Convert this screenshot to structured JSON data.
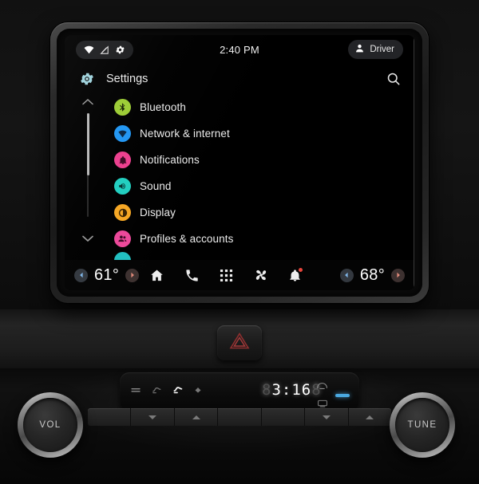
{
  "status_bar": {
    "icons": [
      "wifi-icon",
      "cellular-off-icon",
      "gear-icon"
    ],
    "time": "2:40 PM",
    "profile": {
      "label": "Driver",
      "icon": "person-icon"
    }
  },
  "app_header": {
    "icon": "settings-gear-icon",
    "title": "Settings",
    "search_icon": "search-icon"
  },
  "settings_list": {
    "scroll_up_icon": "chevron-up-icon",
    "scroll_down_icon": "chevron-down-icon",
    "items": [
      {
        "label": "Bluetooth",
        "icon": "bluetooth-icon",
        "color": "#9ccc34"
      },
      {
        "label": "Network & internet",
        "icon": "network-icon",
        "color": "#2196f3"
      },
      {
        "label": "Notifications",
        "icon": "bell-icon",
        "color": "#ec3f8e"
      },
      {
        "label": "Sound",
        "icon": "speaker-icon",
        "color": "#21cfc0"
      },
      {
        "label": "Display",
        "icon": "brightness-icon",
        "color": "#f5a623"
      },
      {
        "label": "Profiles & accounts",
        "icon": "people-icon",
        "color": "#ec4899"
      },
      {
        "label": "",
        "icon": "partial-icon",
        "color": "#21bfc0"
      }
    ]
  },
  "nav_bar": {
    "left_temp": "61°",
    "right_temp": "68°",
    "left_cool_icon": "arrow-left-cool-icon",
    "left_warm_icon": "arrow-right-warm-icon",
    "right_cool_icon": "arrow-left-cool-icon",
    "right_warm_icon": "arrow-right-warm-icon",
    "icons": [
      "home-icon",
      "phone-icon",
      "apps-grid-icon",
      "fan-icon",
      "bell-icon"
    ]
  },
  "hazard_button": {
    "icon": "hazard-triangle-icon"
  },
  "climate_panel": {
    "mode_icons": [
      "airflow-face-icon",
      "airflow-feet-icon",
      "airflow-mix-icon",
      "recirculate-icon"
    ],
    "clock": "3:16",
    "clock_ghost_prefix": "8",
    "clock_ghost_suffix": "8",
    "rear_defrost_icon": "rear-defrost-icon",
    "front_defrost_icon": "front-defrost-icon",
    "indicator": "blue-bar-indicator"
  },
  "knobs": {
    "volume_label": "VOL",
    "tune_label": "TUNE"
  }
}
